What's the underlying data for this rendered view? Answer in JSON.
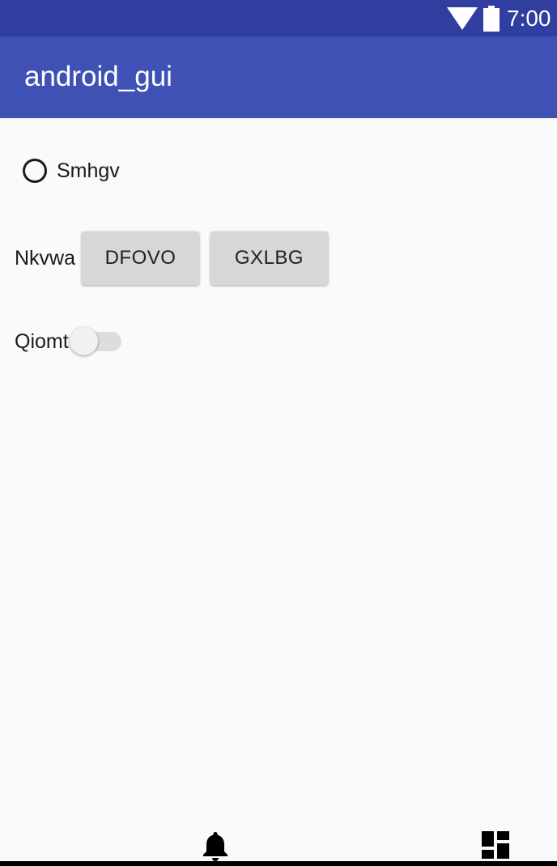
{
  "status_bar": {
    "time": "7:00",
    "color": "#303F9F",
    "wifi_icon": "wifi-icon",
    "battery_icon": "battery-icon"
  },
  "app_bar": {
    "title": "android_gui",
    "color": "#3F51B5"
  },
  "radio": {
    "label": "Smhgv",
    "checked": false
  },
  "button_row": {
    "label": "Nkvwa",
    "buttons": [
      {
        "label": "DFOVO"
      },
      {
        "label": "GXLBG"
      }
    ]
  },
  "switch": {
    "label": "Qiomt",
    "on": false
  },
  "bottom_icons": [
    "bell-icon",
    "dashboard-icon"
  ]
}
